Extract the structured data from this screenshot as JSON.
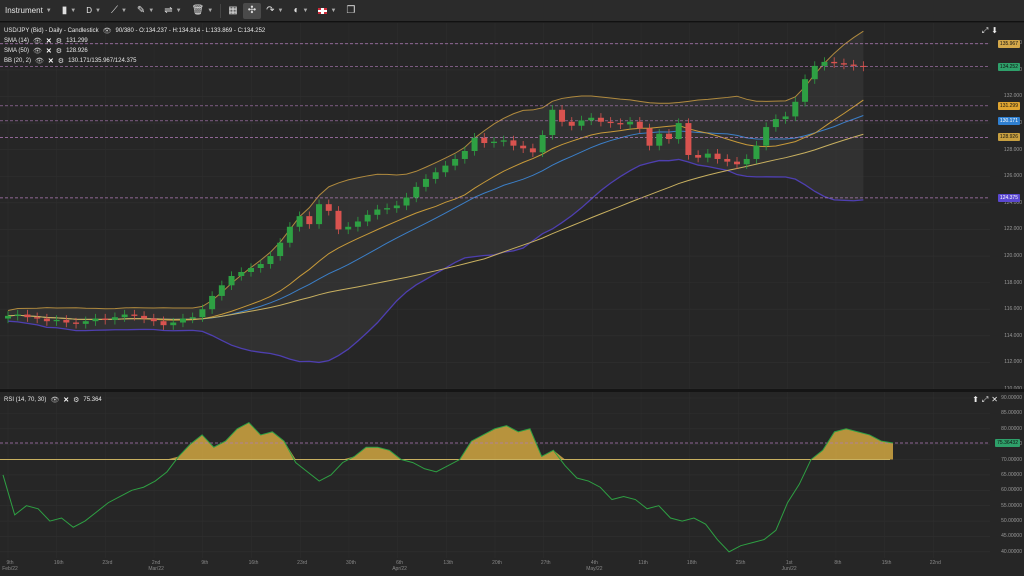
{
  "toolbar": {
    "instrument_label": "Instrument",
    "timeframe": "D",
    "icons": [
      "candlestick-icon",
      "line-tool-icon",
      "pencil-icon",
      "indicators-icon",
      "trash-icon",
      "template-icon",
      "crosshair-icon",
      "share-icon",
      "theme-icon",
      "language-flag-icon",
      "window-icon"
    ]
  },
  "main": {
    "header": "USD/JPY (Bid) - Daily - Candlestick",
    "ohlc": "90/380 - O:134.237 - H:134.814 - L:133.869 - C:134.252",
    "indicators": [
      {
        "name": "SMA (14)",
        "value": "131.299",
        "color": "#e0a530"
      },
      {
        "name": "SMA (50)",
        "value": "128.926",
        "color": "#c8a040"
      },
      {
        "name": "BB (20, 2)",
        "value": "130.171/135.967/124.375",
        "color": "#5050c0"
      }
    ],
    "y_ticks": [
      "136.000",
      "134.000",
      "132.000",
      "130.000",
      "128.000",
      "126.000",
      "124.000",
      "122.000",
      "120.000",
      "118.000",
      "116.000",
      "114.000",
      "112.000",
      "110.000"
    ],
    "price_tags": [
      {
        "label": "135.967",
        "bg": "#d4a84a",
        "value": 135.967
      },
      {
        "label": "134.252",
        "bg": "#2ea06a",
        "value": 134.252
      },
      {
        "label": "131.299",
        "bg": "#e0a530",
        "value": 131.299
      },
      {
        "label": "130.171",
        "bg": "#2f7fd0",
        "value": 130.171
      },
      {
        "label": "128.926",
        "bg": "#c8a040",
        "value": 128.926
      },
      {
        "label": "124.375",
        "bg": "#5a47d0",
        "value": 124.375
      }
    ]
  },
  "rsi": {
    "header": "RSI (14, 70, 30)",
    "value": "75.364",
    "y_ticks": [
      "90.00000",
      "85.00000",
      "80.00000",
      "75.00000",
      "70.00000",
      "65.00000",
      "60.00000",
      "55.00000",
      "50.00000",
      "45.00000",
      "40.00000"
    ],
    "tag": {
      "label": "75.36432",
      "bg": "#2ea06a"
    }
  },
  "x_labels": [
    {
      "label": "9th",
      "sub": "Feb/22"
    },
    {
      "label": "16th",
      "sub": ""
    },
    {
      "label": "23rd",
      "sub": ""
    },
    {
      "label": "2nd",
      "sub": "Mar/22"
    },
    {
      "label": "9th",
      "sub": ""
    },
    {
      "label": "16th",
      "sub": ""
    },
    {
      "label": "23rd",
      "sub": ""
    },
    {
      "label": "30th",
      "sub": ""
    },
    {
      "label": "6th",
      "sub": "Apr/22"
    },
    {
      "label": "13th",
      "sub": ""
    },
    {
      "label": "20th",
      "sub": ""
    },
    {
      "label": "27th",
      "sub": ""
    },
    {
      "label": "4th",
      "sub": "May/22"
    },
    {
      "label": "11th",
      "sub": ""
    },
    {
      "label": "18th",
      "sub": ""
    },
    {
      "label": "25th",
      "sub": ""
    },
    {
      "label": "1st",
      "sub": "Jun/22"
    },
    {
      "label": "8th",
      "sub": ""
    },
    {
      "label": "15th",
      "sub": ""
    },
    {
      "label": "22nd",
      "sub": ""
    }
  ],
  "chart_data": {
    "type": "candlestick",
    "ylim": [
      110,
      137
    ],
    "horizontal_levels": [
      135.967,
      134.252,
      131.299,
      130.171,
      128.926,
      124.375
    ],
    "closes": [
      115.5,
      115.6,
      115.4,
      115.3,
      115.1,
      115.2,
      115.0,
      114.9,
      115.1,
      115.3,
      115.2,
      115.4,
      115.6,
      115.5,
      115.3,
      115.1,
      114.8,
      115.0,
      115.3,
      115.4,
      116.0,
      117.0,
      117.8,
      118.5,
      118.8,
      119.1,
      119.4,
      120.0,
      121.0,
      122.2,
      123.0,
      122.4,
      123.9,
      123.4,
      122.0,
      122.2,
      122.6,
      123.1,
      123.5,
      123.6,
      123.8,
      124.4,
      125.2,
      125.8,
      126.3,
      126.8,
      127.3,
      127.9,
      128.9,
      128.5,
      128.6,
      128.7,
      128.3,
      128.1,
      127.8,
      129.1,
      131.0,
      130.1,
      129.8,
      130.2,
      130.4,
      130.1,
      130.0,
      129.9,
      130.1,
      129.6,
      128.3,
      129.2,
      128.8,
      130.0,
      127.6,
      127.4,
      127.7,
      127.3,
      127.1,
      126.9,
      127.3,
      128.3,
      129.7,
      130.3,
      130.5,
      131.6,
      133.3,
      134.3,
      134.6,
      134.5,
      134.4,
      134.3,
      134.25
    ],
    "rsi": [
      65,
      52,
      55,
      54,
      50,
      51,
      48,
      50,
      53,
      56,
      58,
      60,
      61,
      63,
      66,
      71,
      75,
      78,
      74,
      76,
      80,
      82,
      78,
      79,
      76,
      69,
      66,
      63,
      65,
      69,
      71,
      74,
      74,
      73,
      70,
      69,
      67,
      66,
      68,
      70,
      76,
      78,
      80,
      81,
      79,
      80,
      71,
      73,
      68,
      64,
      63,
      61,
      57,
      58,
      57,
      54,
      55,
      51,
      50,
      51,
      49,
      44,
      40,
      42,
      43,
      44,
      47,
      56,
      62,
      70,
      73,
      79,
      80,
      79,
      78,
      76,
      75.364
    ]
  }
}
